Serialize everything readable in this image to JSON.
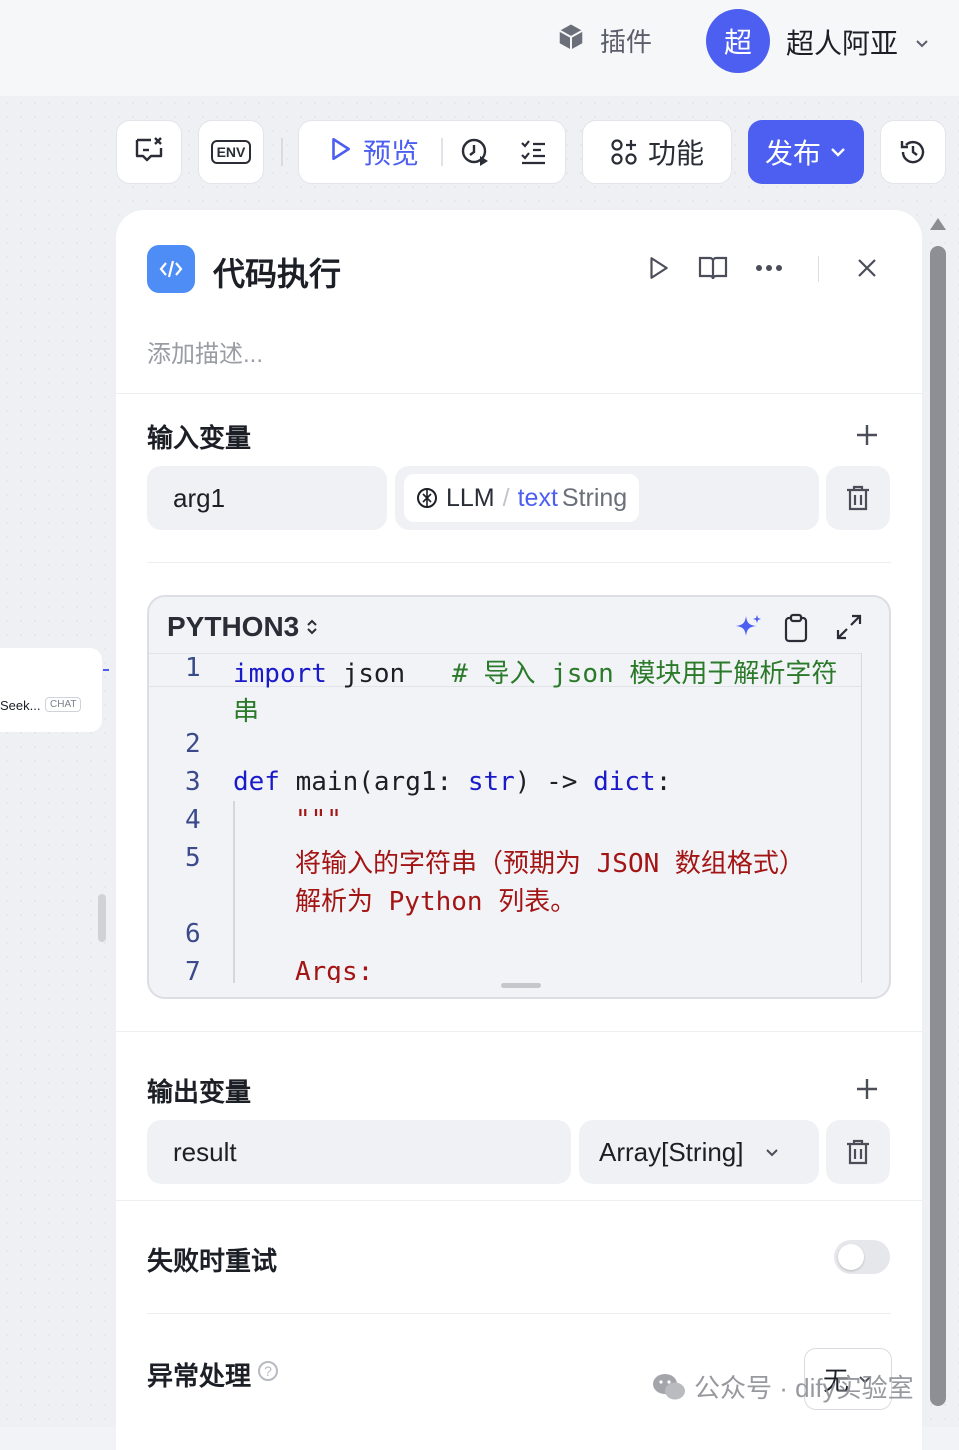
{
  "header": {
    "plugin_label": "插件",
    "avatar_char": "超",
    "user_name": "超人阿亚"
  },
  "toolbar": {
    "env_label": "ENV",
    "preview_label": "预览",
    "features_label": "功能",
    "publish_label": "发布"
  },
  "canvas": {
    "node_label": "Seek...",
    "node_chip": "CHAT"
  },
  "node": {
    "title": "代码执行",
    "description_placeholder": "添加描述...",
    "inputs": {
      "section_title": "输入变量",
      "rows": [
        {
          "name": "arg1",
          "source": "LLM",
          "separator": "/",
          "var": "text",
          "type": "String"
        }
      ]
    },
    "code": {
      "language": "PYTHON3",
      "line_numbers": [
        "1",
        "2",
        "3",
        "4",
        "5",
        "6",
        "7"
      ],
      "line1_kw": "import",
      "line1_rest": " json   ",
      "line1_comment": "# 导入 json 模块用于解析字符",
      "line1_wrap": "串",
      "line3_kw": "def",
      "line3_fn": " main(arg1: ",
      "line3_type": "str",
      "line3_mid": ") -> ",
      "line3_ret": "dict",
      "line3_end": ":",
      "line4": "\"\"\"",
      "line5a": "将输入的字符串（预期为 JSON 数组格式）",
      "line5b": "解析为 Python 列表。",
      "line7": "Args:"
    },
    "outputs": {
      "section_title": "输出变量",
      "rows": [
        {
          "name": "result",
          "type": "Array[String]"
        }
      ]
    },
    "retry": {
      "label": "失败时重试",
      "enabled": false
    },
    "exception": {
      "label": "异常处理",
      "help": "?",
      "value": "无"
    }
  },
  "watermark": {
    "text": "公众号 · dify实验室"
  },
  "colors": {
    "accent": "#4c5ff0",
    "code_blue": "#4d8df5"
  }
}
